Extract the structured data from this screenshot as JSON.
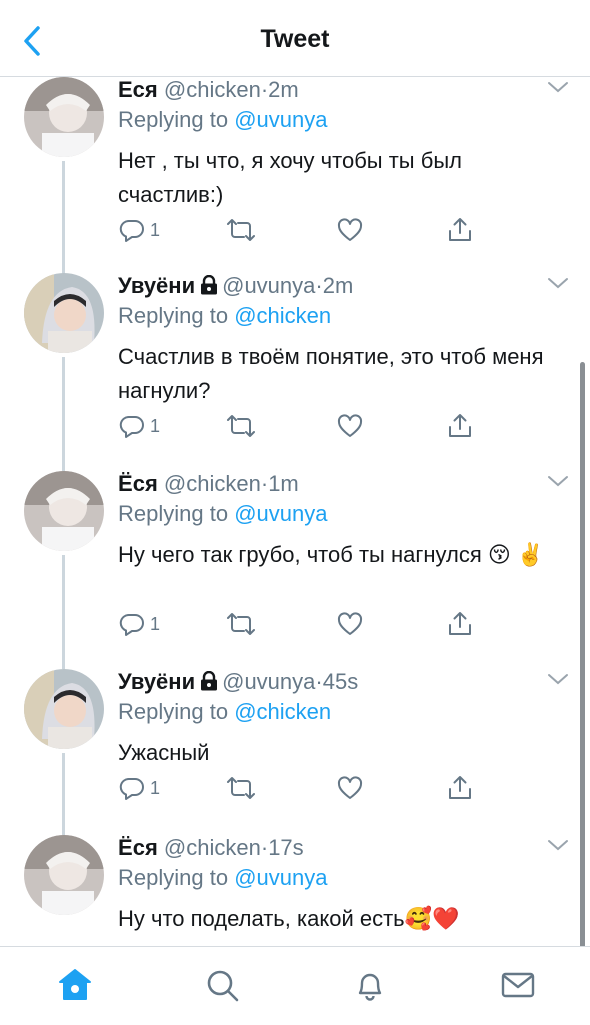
{
  "header": {
    "title": "Tweet"
  },
  "tweets": [
    {
      "name": "Еся",
      "locked": false,
      "handle": "@chicken",
      "time": "2m",
      "replying_prefix": "Replying to",
      "replying_to": "@uvunya",
      "text": "Нет , ты что, я хочу чтобы ты был счастлив:)",
      "reply_count": "1"
    },
    {
      "name": "Увуёни",
      "locked": true,
      "handle": "@uvunya",
      "time": "2m",
      "replying_prefix": "Replying to",
      "replying_to": "@chicken",
      "text": "Счастлив в твоём понятие, это чтоб меня нагнули?",
      "reply_count": "1"
    },
    {
      "name": "Ёся",
      "locked": false,
      "handle": "@chicken",
      "time": "1m",
      "replying_prefix": "Replying to",
      "replying_to": "@uvunya",
      "text": "Ну чего так грубо, чтоб ты нагнулся 😚 ✌️",
      "reply_count": "1"
    },
    {
      "name": "Увуёни",
      "locked": true,
      "handle": "@uvunya",
      "time": "45s",
      "replying_prefix": "Replying to",
      "replying_to": "@chicken",
      "text": "Ужасный",
      "reply_count": "1"
    },
    {
      "name": "Ёся",
      "locked": false,
      "handle": "@chicken",
      "time": "17s",
      "replying_prefix": "Replying to",
      "replying_to": "@uvunya",
      "text": "Ну что поделать, какой есть🥰❤️",
      "reply_count": ""
    }
  ],
  "colors": {
    "accent": "#1da1f2",
    "muted": "#657786",
    "divider": "#d6dbe0"
  },
  "tabs": [
    "home-icon",
    "search-icon",
    "notifications-icon",
    "messages-icon"
  ]
}
